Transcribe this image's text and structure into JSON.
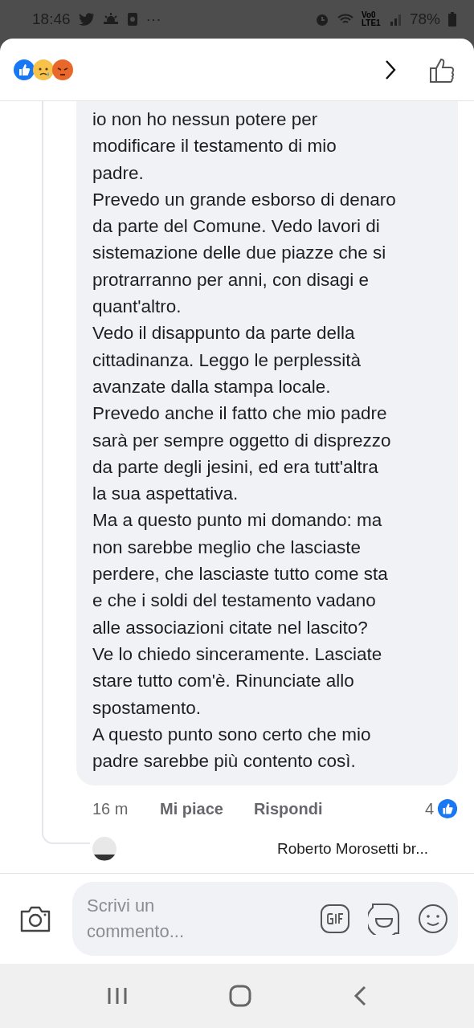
{
  "status_bar": {
    "time": "18:46",
    "more": "···",
    "network": "Vo0 LTE1",
    "battery": "78%"
  },
  "comment": {
    "paragraphs": [
      [
        "io non ho nessun potere per",
        "modificare il testamento di mio",
        "padre."
      ],
      [
        "Prevedo un grande esborso di denaro",
        "da parte del Comune. Vedo lavori di",
        "sistemazione delle due piazze che si",
        "protrarranno per anni, con disagi e",
        "quant'altro."
      ],
      [
        "Vedo il disappunto da parte della",
        "cittadinanza. Leggo le perplessità",
        "avanzate dalla stampa locale."
      ],
      [
        "Prevedo anche il fatto che mio padre",
        "sarà per sempre oggetto di disprezzo",
        "da parte degli jesini, ed era tutt'altra",
        "la sua aspettativa."
      ],
      [
        "Ma a questo punto mi domando: ma",
        "non sarebbe meglio che lasciaste",
        "perdere, che lasciaste tutto come sta",
        "e che i soldi del testamento vadano",
        "alle associazioni citate nel lascito?"
      ],
      [
        "Ve lo chiedo sinceramente. Lasciate",
        "stare tutto com'è. Rinunciate allo",
        "spostamento."
      ],
      [
        "A questo punto sono certo che mio",
        "padre sarebbe più contento così."
      ]
    ],
    "time": "16 m",
    "actions": [
      "Mi piace",
      "Rispondi"
    ],
    "like_count": "4"
  },
  "reply_preview": {
    "text": "Roberto Morosetti br..."
  },
  "composer": {
    "placeholder": "Scrivi un commento..."
  }
}
